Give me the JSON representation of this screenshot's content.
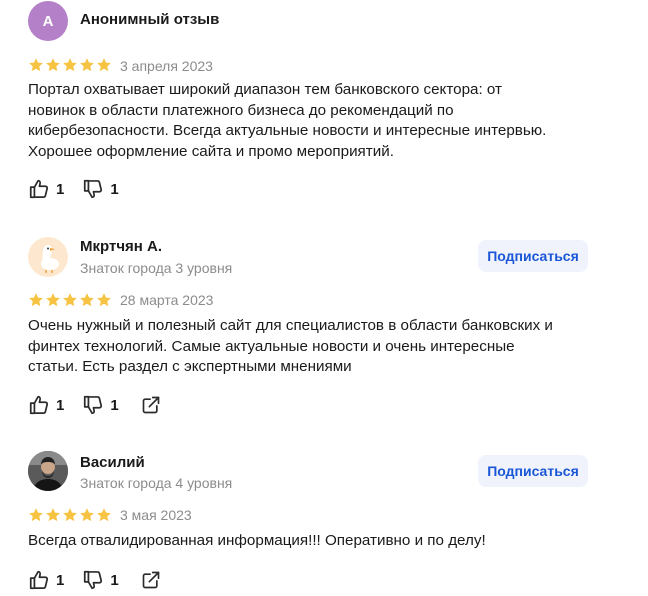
{
  "reviews": [
    {
      "avatar_letter": "A",
      "avatar_color": "#b480c8",
      "name": "Анонимный отзыв",
      "subtitle": "",
      "rating": 5,
      "date": "3 апреля 2023",
      "text": "Портал охватывает широкий диапазон тем банковского сектора: от\nновинок в области платежного бизнеса до рекомендаций по\nкибербезопасности. Всегда актуальные новости и интересные интервью.\nХорошее оформление сайта и промо мероприятий.",
      "likes": "1",
      "dislikes": "1"
    },
    {
      "avatar_icon": "goose-avatar",
      "name": "Мкртчян А.",
      "subtitle": "Знаток города 3 уровня",
      "subscribe_label": "Подписаться",
      "rating": 5,
      "date": "28 марта 2023",
      "text": "Очень нужный и полезный сайт для специалистов в области банковских и\nфинтех технологий. Самые актуальные новости и очень интересные\nстатьи. Есть раздел с экспертными мнениями",
      "likes": "1",
      "dislikes": "1"
    },
    {
      "avatar_icon": "user-photo-avatar",
      "name": "Василий",
      "subtitle": "Знаток города 4 уровня",
      "subscribe_label": "Подписаться",
      "rating": 5,
      "date": "3 мая 2023",
      "text": "Всегда отвалидированная информация!!! Оперативно и по делу!",
      "likes": "1",
      "dislikes": "1"
    }
  ],
  "colors": {
    "star": "#f6c343",
    "accent": "#1a57d6",
    "subscribe_bg": "#f0f3fc",
    "muted_text": "#8c8c8c"
  }
}
